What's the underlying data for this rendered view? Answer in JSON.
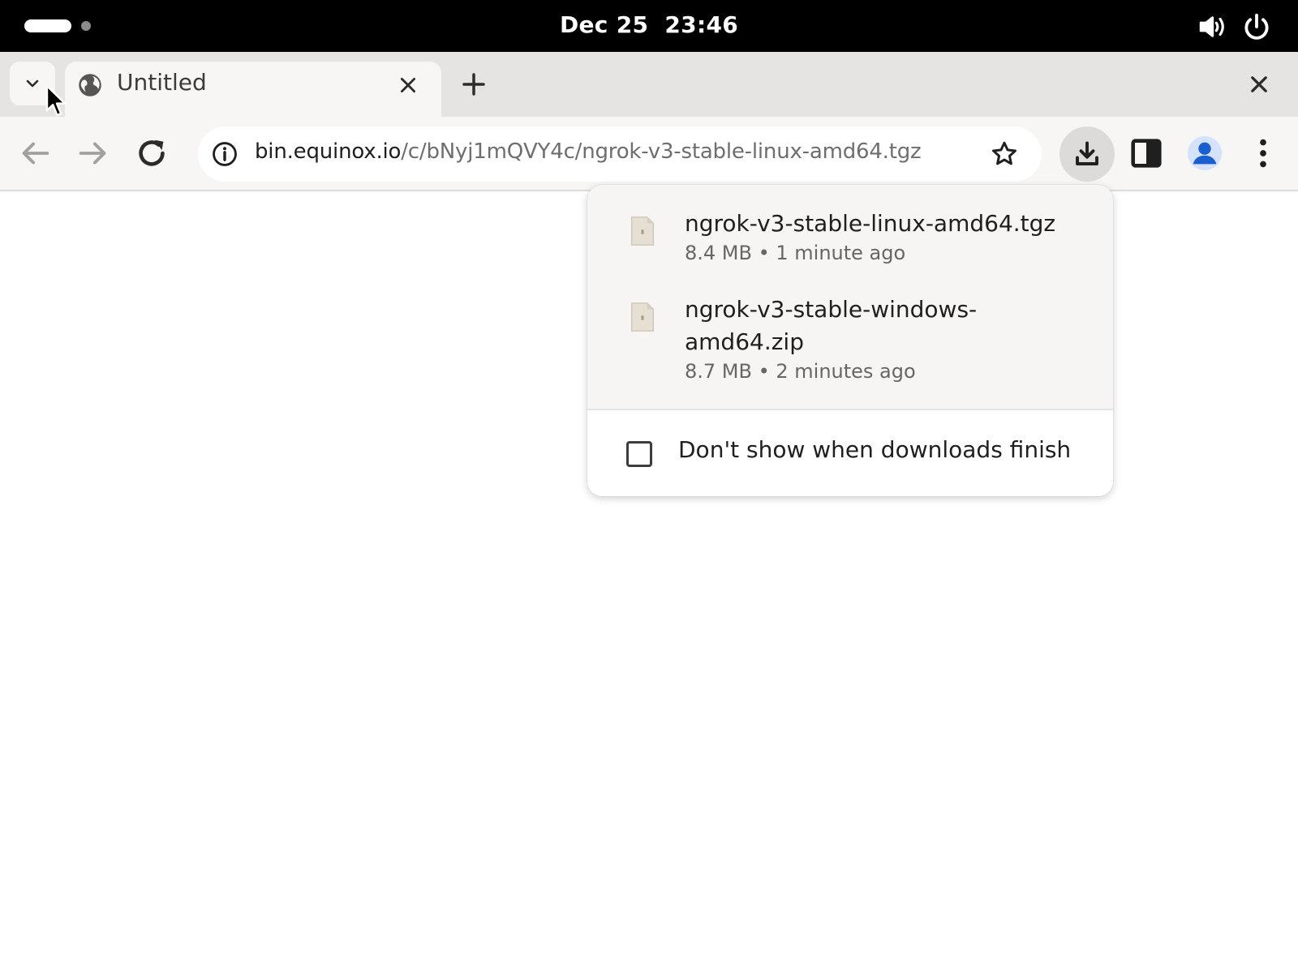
{
  "system_bar": {
    "clock": "Dec 25  23:46",
    "icons": [
      "volume-icon",
      "power-icon"
    ]
  },
  "browser": {
    "tabs": [
      {
        "title": "Untitled",
        "favicon": "globe-icon",
        "active": true
      }
    ],
    "toolbar": {
      "url_host": "bin.equinox.io",
      "url_path": "/c/bNyj1mQVY4c/ngrok-v3-stable-linux-amd64.tgz",
      "icons": [
        "back-icon",
        "forward-icon",
        "reload-icon",
        "site-info-icon",
        "bookmark-star-icon",
        "download-icon",
        "side-panel-icon",
        "profile-icon",
        "menu-icon"
      ]
    }
  },
  "downloads": {
    "items": [
      {
        "name": "ngrok-v3-stable-linux-amd64.tgz",
        "size": "8.4 MB",
        "time": "1 minute ago",
        "meta": "8.4 MB • 1 minute ago"
      },
      {
        "name": "ngrok-v3-stable-windows-amd64.zip",
        "name_line1": "ngrok-v3-stable-windows-",
        "name_line2": "amd64.zip",
        "size": "8.7 MB",
        "time": "2 minutes ago",
        "meta": "8.7 MB • 2 minutes ago"
      }
    ],
    "dont_show_label": "Don't show when downloads finish",
    "dont_show_checked": false
  },
  "colors": {
    "topbar": "#000000",
    "tabstrip": "#e6e4e3",
    "toolbar": "#f7f6f5",
    "profile_accent": "#1a5fd0"
  }
}
